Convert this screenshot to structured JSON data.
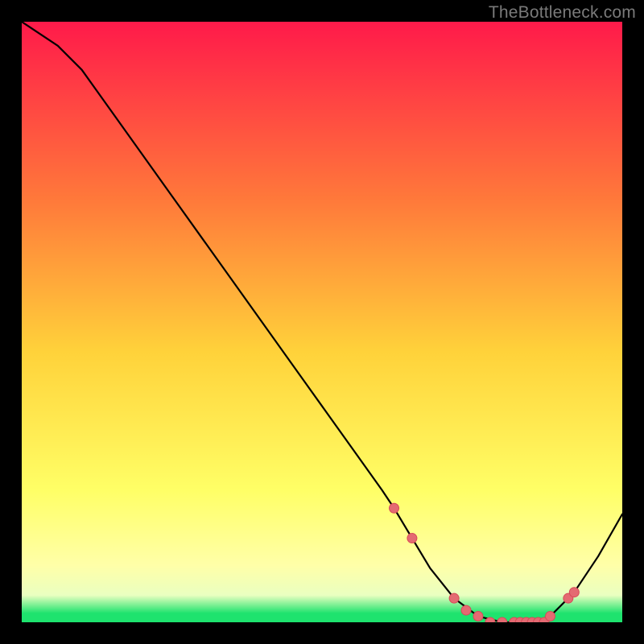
{
  "watermark": "TheBottleneck.com",
  "colors": {
    "frame": "#000000",
    "gradient_top": "#ff1a4a",
    "gradient_mid_upper": "#ff7a3a",
    "gradient_mid": "#ffd23a",
    "gradient_mid_lower": "#ffff66",
    "gradient_yellow_light": "#ffffa8",
    "gradient_pale": "#eaffc0",
    "gradient_green": "#1ee36e",
    "curve": "#000000",
    "marker_fill": "#e46a72",
    "marker_stroke": "#d74a58"
  },
  "chart_data": {
    "type": "line",
    "title": "",
    "xlabel": "",
    "ylabel": "",
    "xlim": [
      0,
      100
    ],
    "ylim": [
      0,
      100
    ],
    "series": [
      {
        "name": "bottleneck-curve",
        "x": [
          0,
          3,
          6,
          10,
          15,
          20,
          25,
          30,
          35,
          40,
          45,
          50,
          55,
          60,
          62,
          65,
          68,
          72,
          76,
          80,
          83,
          85,
          88,
          92,
          96,
          100
        ],
        "y": [
          100,
          98,
          96,
          92,
          85,
          78,
          71,
          64,
          57,
          50,
          43,
          36,
          29,
          22,
          19,
          14,
          9,
          4,
          1,
          0,
          0,
          0,
          1,
          5,
          11,
          18
        ]
      }
    ],
    "markers": {
      "name": "highlight-dots",
      "x": [
        62,
        65,
        72,
        74,
        76,
        78,
        80,
        82,
        83,
        84,
        85,
        86,
        87,
        88,
        91,
        92
      ],
      "y": [
        19,
        14,
        4,
        2,
        1,
        0,
        0,
        0,
        0,
        0,
        0,
        0,
        0,
        1,
        4,
        5
      ]
    }
  }
}
